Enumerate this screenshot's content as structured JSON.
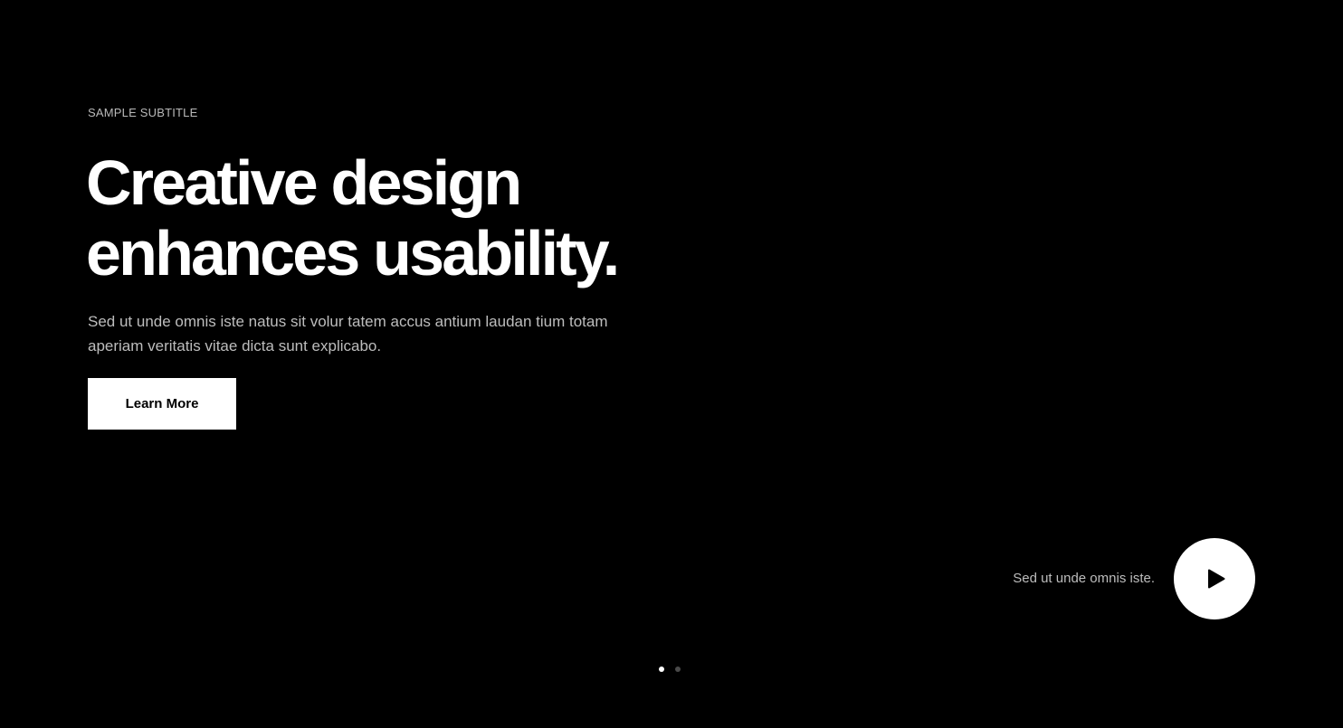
{
  "hero": {
    "subtitle": "SAMPLE SUBTITLE",
    "headline_line1": "Creative design",
    "headline_line2": "enhances usability.",
    "description": "Sed ut unde omnis iste natus sit volur tatem accus antium laudan tium totam aperiam veritatis vitae dicta sunt explicabo.",
    "cta_label": "Learn More"
  },
  "video": {
    "caption": "Sed ut unde omnis iste.",
    "icon": "play-icon"
  },
  "slider": {
    "slides_count": 2,
    "active_index": 0
  },
  "colors": {
    "background": "#000000",
    "text_primary": "#ffffff",
    "text_secondary": "#bdbdbd",
    "button_bg": "#ffffff",
    "button_text": "#000000",
    "dot_inactive": "#4a4a4a"
  }
}
